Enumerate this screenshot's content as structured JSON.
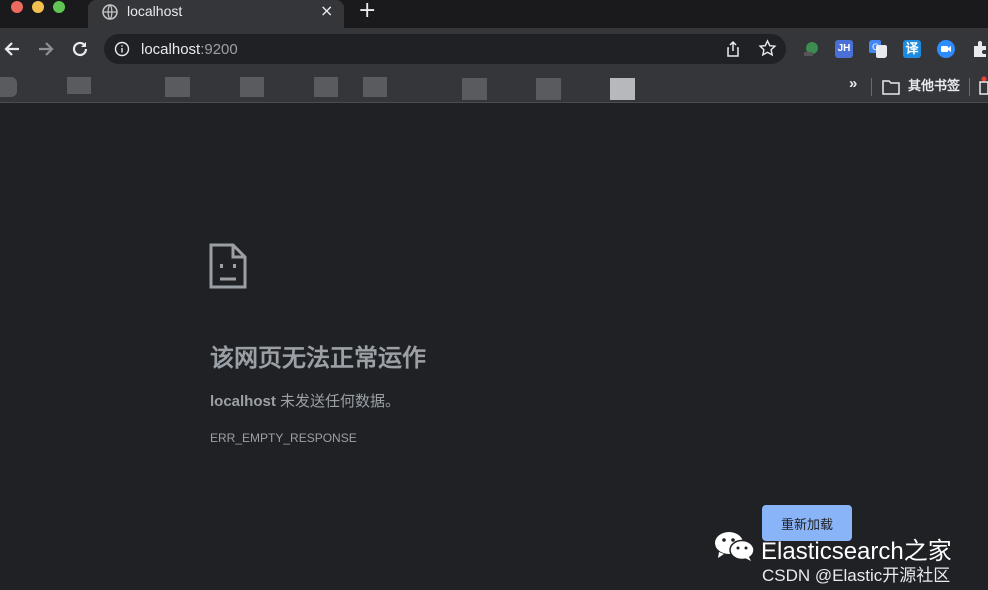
{
  "tab": {
    "title": "localhost",
    "close_glyph": "×",
    "new_tab_glyph": "+"
  },
  "omnibox": {
    "host": "localhost",
    "port": ":9200"
  },
  "extensions": {
    "jh_label": "JH",
    "translate_label": "译"
  },
  "bookmarks": {
    "more_glyph": "»",
    "other_label": "其他书签"
  },
  "error": {
    "title": "该网页无法正常运作",
    "desc_host": "localhost",
    "desc_text": " 未发送任何数据。",
    "code": "ERR_EMPTY_RESPONSE",
    "reload_label": "重新加载"
  },
  "watermark": {
    "title": "Elasticsearch之家",
    "subtitle": "CSDN @Elastic开源社区"
  },
  "colors": {
    "page_bg": "#202124",
    "toolbar_bg": "#35363a",
    "accent": "#8ab4f8",
    "muted_text": "#9aa0a6"
  }
}
